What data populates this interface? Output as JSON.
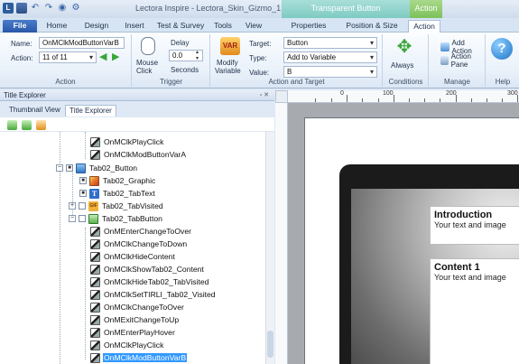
{
  "window": {
    "title": "Lectora Inspire - Lectora_Skin_Gizmo_1",
    "context_tab_transparent_button": "Transparent Button",
    "context_tab_action": "Action"
  },
  "tabs": [
    "File",
    "Home",
    "Design",
    "Insert",
    "Test & Survey",
    "Tools",
    "View",
    "Properties",
    "Position & Size",
    "Action"
  ],
  "ribbon": {
    "action_group": {
      "name_label": "Name:",
      "name_value": "OnMClkModButtonVarB",
      "action_label": "Action:",
      "action_value": "11 of 11",
      "group_label": "Action"
    },
    "trigger_group": {
      "mouse_click_label_1": "Mouse",
      "mouse_click_label_2": "Click",
      "delay_label": "Delay",
      "delay_value": "0.0",
      "seconds_label": "Seconds",
      "group_label": "Trigger"
    },
    "action_target_group": {
      "modify_variable_label_1": "Modify",
      "modify_variable_label_2": "Variable",
      "target_label": "Target:",
      "target_value": "Button",
      "type_label": "Type:",
      "type_value": "Add to Variable",
      "value_label": "Value:",
      "value_value": "B",
      "group_label": "Action and Target"
    },
    "conditions_group": {
      "always_label": "Always",
      "group_label": "Conditions"
    },
    "manage_group": {
      "add_action_label": "Add Action",
      "action_pane_label": "Action Pane",
      "group_label": "Manage"
    },
    "help_group": {
      "group_label": "Help"
    }
  },
  "title_explorer": {
    "header": "Title Explorer",
    "tab_thumbnail": "Thumbnail View",
    "tab_title_explorer": "Title Explorer",
    "tree": [
      {
        "label": "OnMClkPlayClick",
        "icon": "event-icon",
        "selected": false
      },
      {
        "label": "OnMClkModButtonVarA",
        "icon": "event-icon",
        "selected": false
      },
      {
        "label": "Tab02_Button",
        "icon": "button-icon",
        "selected": false
      },
      {
        "label": "Tab02_Graphic",
        "icon": "image-icon",
        "selected": false
      },
      {
        "label": "Tab02_TabText",
        "icon": "text-icon",
        "selected": false
      },
      {
        "label": "Tab02_TabVisited",
        "icon": "gif-icon",
        "selected": false
      },
      {
        "label": "Tab02_TabButton",
        "icon": "tab-button-icon",
        "selected": false
      },
      {
        "label": "OnMEnterChangeToOver",
        "icon": "event-icon",
        "selected": false
      },
      {
        "label": "OnMClkChangeToDown",
        "icon": "event-icon",
        "selected": false
      },
      {
        "label": "OnMClkHideContent",
        "icon": "event-icon",
        "selected": false
      },
      {
        "label": "OnMClkShowTab02_Content",
        "icon": "event-icon",
        "selected": false
      },
      {
        "label": "OnMClkHideTab02_TabVisited",
        "icon": "event-icon",
        "selected": false
      },
      {
        "label": "OnMClkSetTIRLI_Tab02_Visited",
        "icon": "event-icon",
        "selected": false
      },
      {
        "label": "OnMClkChangeToOver",
        "icon": "event-icon",
        "selected": false
      },
      {
        "label": "OnMExitChangeToUp",
        "icon": "event-icon",
        "selected": false
      },
      {
        "label": "OnMEnterPlayHover",
        "icon": "event-icon",
        "selected": false
      },
      {
        "label": "OnMClkPlayClick",
        "icon": "event-icon",
        "selected": false
      },
      {
        "label": "OnMClkModButtonVarB",
        "icon": "event-icon",
        "selected": true
      }
    ]
  },
  "ruler": {
    "labels": [
      "0",
      "100",
      "200",
      "300"
    ]
  },
  "canvas": {
    "cards": [
      {
        "title": "Introduction",
        "body": "Your text and image"
      },
      {
        "title": "Content 1",
        "body": "Your text and image"
      }
    ]
  },
  "colors": {
    "accent": "#2857a8",
    "selection": "#3399ff",
    "context_action": "#7dc15a",
    "context_button": "#7ecbc2"
  }
}
